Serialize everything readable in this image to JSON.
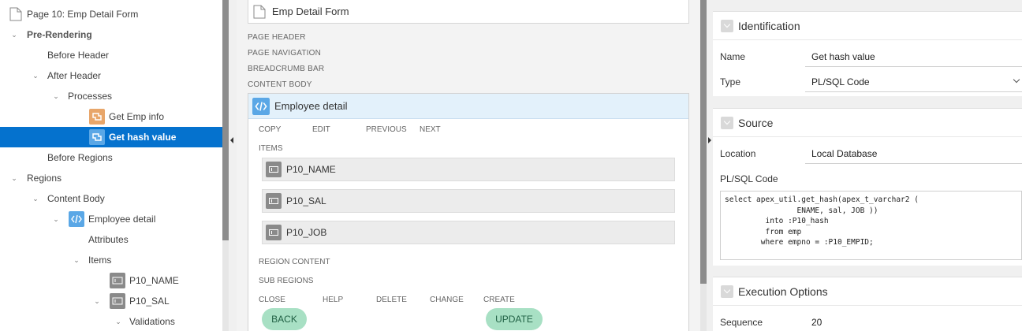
{
  "tree": {
    "page_title": "Page 10: Emp Detail Form",
    "nodes": [
      {
        "label": "Pre-Rendering",
        "bold": true
      },
      {
        "label": "Before Header"
      },
      {
        "label": "After Header"
      },
      {
        "label": "Processes"
      },
      {
        "label": "Get Emp info"
      },
      {
        "label": "Get hash value",
        "selected": true
      },
      {
        "label": "Before Regions"
      },
      {
        "label": "Regions"
      },
      {
        "label": "Content Body"
      },
      {
        "label": "Employee detail"
      },
      {
        "label": "Attributes"
      },
      {
        "label": "Items"
      },
      {
        "label": "P10_NAME"
      },
      {
        "label": "P10_SAL"
      },
      {
        "label": "Validations"
      }
    ]
  },
  "layout": {
    "page_title": "Emp Detail Form",
    "sections": [
      "PAGE HEADER",
      "PAGE NAVIGATION",
      "BREADCRUMB BAR",
      "CONTENT BODY"
    ],
    "region": {
      "title": "Employee detail",
      "button_positions": [
        "COPY",
        "EDIT",
        "PREVIOUS",
        "NEXT"
      ],
      "items_label": "ITEMS",
      "items": [
        "P10_NAME",
        "P10_SAL",
        "P10_JOB"
      ],
      "region_content_label": "REGION CONTENT",
      "sub_regions_label": "SUB REGIONS",
      "bottom_positions": [
        "CLOSE",
        "HELP",
        "DELETE",
        "CHANGE",
        "CREATE"
      ],
      "back_button": "BACK",
      "update_button": "UPDATE"
    }
  },
  "properties": {
    "identification": {
      "title": "Identification",
      "name_label": "Name",
      "name_value": "Get hash value",
      "type_label": "Type",
      "type_value": "PL/SQL Code"
    },
    "source": {
      "title": "Source",
      "location_label": "Location",
      "location_value": "Local Database",
      "code_label": "PL/SQL Code",
      "code": "select apex_util.get_hash(apex_t_varchar2 (\n                ENAME, sal, JOB ))\n         into :P10_hash\n         from emp\n        where empno = :P10_EMPID;"
    },
    "execution": {
      "title": "Execution Options",
      "sequence_label": "Sequence",
      "sequence_value": "20"
    }
  },
  "colors": {
    "selection": "#0572ce",
    "region_header": "#e3f1fb",
    "pill_button": "#a8e0c4",
    "process_icon": "#e8a66a"
  }
}
